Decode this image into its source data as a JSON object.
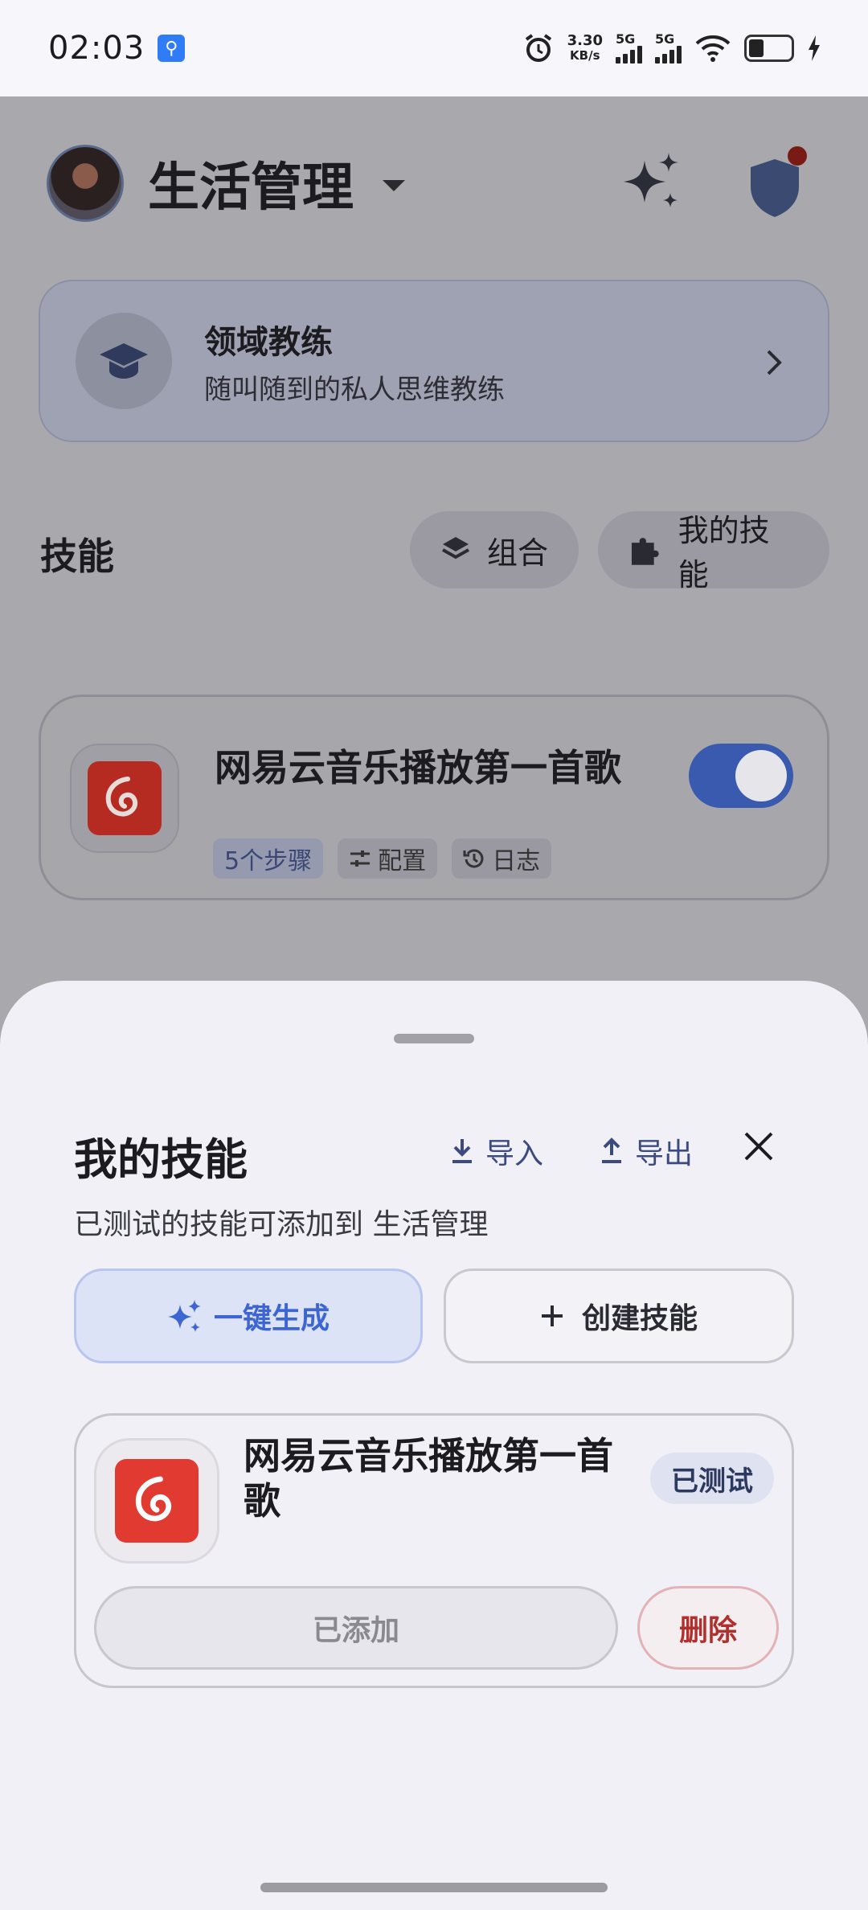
{
  "status_bar": {
    "time": "02:03",
    "net_speed_value": "3.30",
    "net_speed_unit": "KB/s",
    "sim1": "5G",
    "sim2": "5G"
  },
  "header": {
    "app_title": "生活管理"
  },
  "coach_card": {
    "title": "领域教练",
    "subtitle": "随叫随到的私人思维教练"
  },
  "skills_section": {
    "title": "技能",
    "combo_label": "组合",
    "my_skills_label": "我的技能"
  },
  "skill_card": {
    "name": "网易云音乐播放第一首歌",
    "enabled": true,
    "tags": {
      "steps": "5个步骤",
      "config": "配置",
      "log": "日志"
    }
  },
  "sheet": {
    "title": "我的技能",
    "import_label": "导入",
    "export_label": "导出",
    "subtitle": "已测试的技能可添加到 生活管理",
    "generate_label": "一键生成",
    "create_label": "创建技能",
    "item": {
      "name": "网易云音乐播放第一首歌",
      "badge": "已测试",
      "added_label": "已添加",
      "delete_label": "删除"
    }
  },
  "colors": {
    "accent": "#3d66d4",
    "toggle_on": "#3a5ab0",
    "danger": "#b0302d",
    "netease_red": "#e13b31"
  }
}
